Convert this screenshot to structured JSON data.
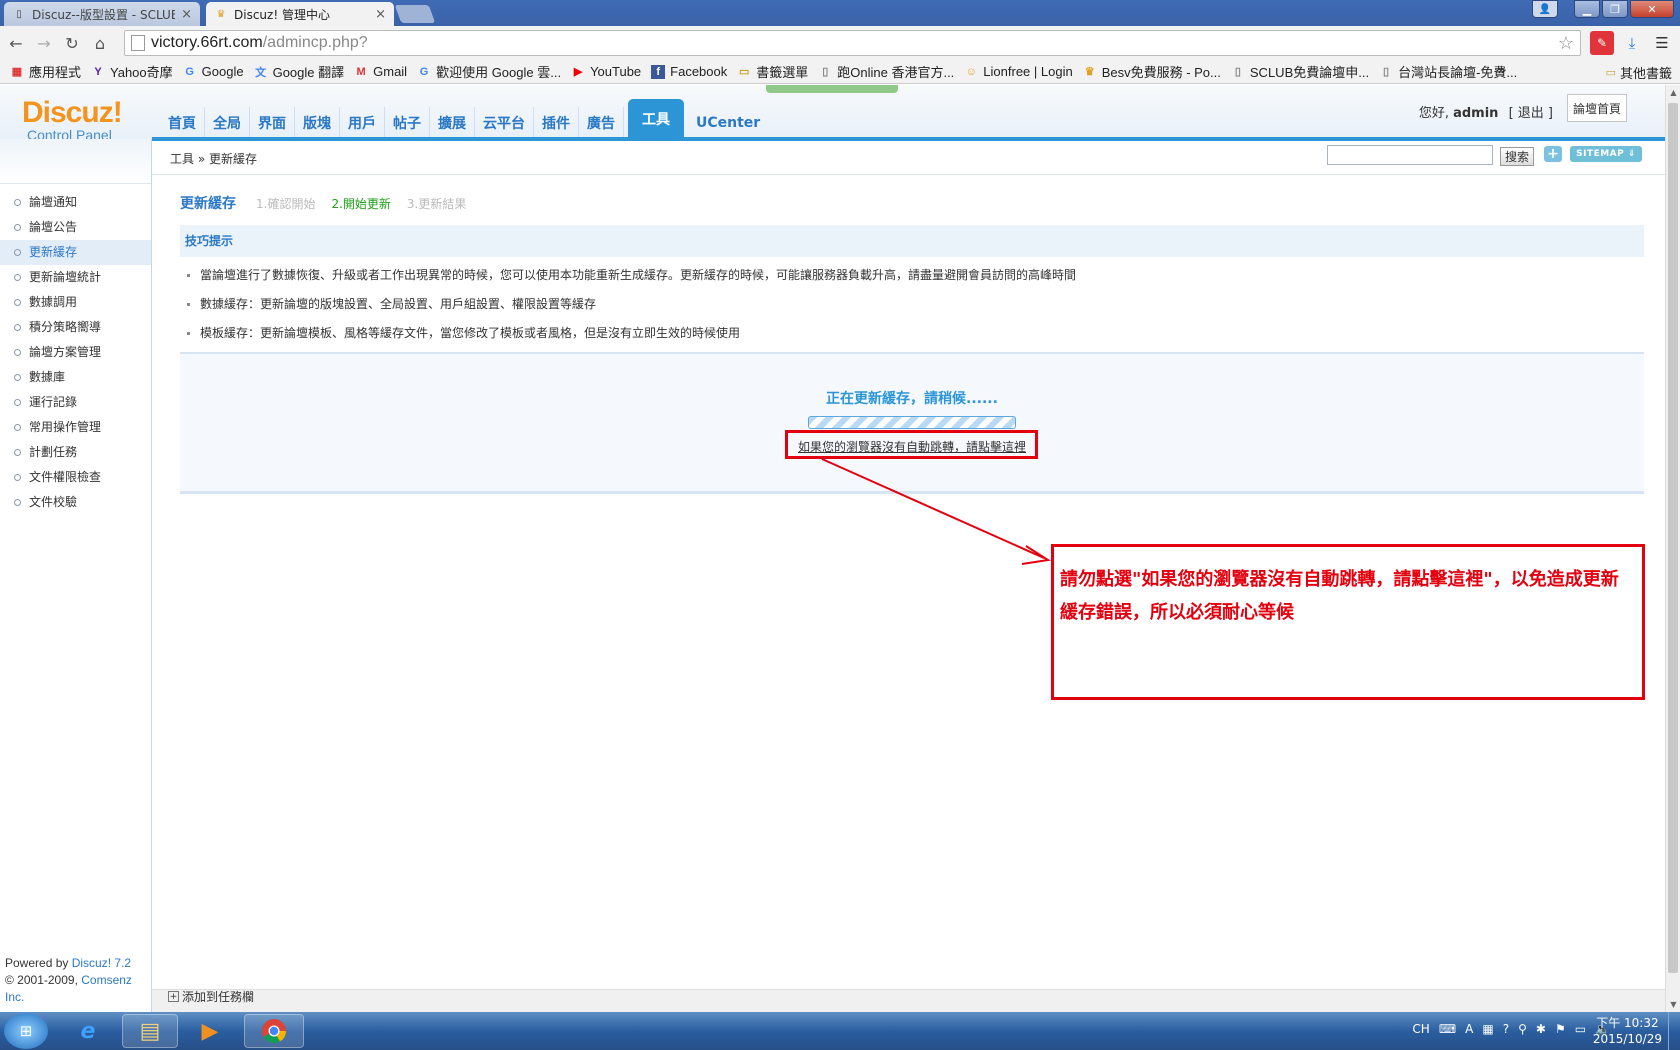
{
  "browser": {
    "tabs": [
      {
        "title": "Discuz--版型設置 - SCLUB",
        "active": false,
        "close": "×"
      },
      {
        "title": "Discuz! 管理中心",
        "active": true,
        "close": "×"
      }
    ],
    "window_controls": {
      "minimize": "▁",
      "maximize": "❐",
      "close": "✕"
    },
    "url_host": "victory.66rt.com",
    "url_path": "/admincp.php?",
    "bookmarks": [
      {
        "label": "應用程式",
        "icon": "apps-icon"
      },
      {
        "label": "Yahoo奇摩",
        "icon": "yahoo-icon"
      },
      {
        "label": "Google",
        "icon": "google-icon"
      },
      {
        "label": "Google 翻譯",
        "icon": "google-translate-icon"
      },
      {
        "label": "Gmail",
        "icon": "gmail-icon"
      },
      {
        "label": "歡迎使用 Google 雲...",
        "icon": "google-icon"
      },
      {
        "label": "YouTube",
        "icon": "youtube-icon"
      },
      {
        "label": "Facebook",
        "icon": "facebook-icon"
      },
      {
        "label": "書籤選單",
        "icon": "folder-icon"
      },
      {
        "label": "跑Online 香港官方...",
        "icon": "page-icon"
      },
      {
        "label": "Lionfree | Login",
        "icon": "lionfree-icon"
      },
      {
        "label": "Besv免費服務 - Po...",
        "icon": "trophy-icon"
      },
      {
        "label": "SCLUB免費論壇申...",
        "icon": "page-icon"
      },
      {
        "label": "台灣站長論壇-免費...",
        "icon": "page-icon"
      }
    ],
    "bookmarks_more": "»",
    "bookmarks_other": "其他書籤"
  },
  "header": {
    "logo_title": "Discuz!",
    "logo_sub": "Control Panel",
    "nav": [
      "首頁",
      "全局",
      "界面",
      "版塊",
      "用戶",
      "帖子",
      "擴展",
      "云平台",
      "插件",
      "廣告",
      "工具",
      "UCenter"
    ],
    "nav_active": "工具",
    "user_greeting": "您好,",
    "user_name": "admin",
    "logout": "[ 退出 ]",
    "forum_home": "論壇首頁"
  },
  "crumb": {
    "path": "工具 » 更新緩存",
    "search_button": "搜索",
    "plus": "+",
    "sitemap": "SITEMAP ⇓"
  },
  "sidebar": {
    "items": [
      {
        "label": "論壇通知"
      },
      {
        "label": "論壇公告"
      },
      {
        "label": "更新緩存",
        "active": true
      },
      {
        "label": "更新論壇統計"
      },
      {
        "label": "數據調用"
      },
      {
        "label": "積分策略嚮導"
      },
      {
        "label": "論壇方案管理"
      },
      {
        "label": "數據庫"
      },
      {
        "label": "運行記錄"
      },
      {
        "label": "常用操作管理"
      },
      {
        "label": "計劃任務"
      },
      {
        "label": "文件權限檢查"
      },
      {
        "label": "文件校驗"
      }
    ],
    "powered_by": "Powered by",
    "powered_link": "Discuz! 7.2",
    "copyright": "© 2001-2009,",
    "copyright_link": "Comsenz Inc."
  },
  "main": {
    "title": "更新緩存",
    "steps": [
      {
        "label": "1.確認開始",
        "current": false
      },
      {
        "label": "2.開始更新",
        "current": true
      },
      {
        "label": "3.更新結果",
        "current": false
      }
    ],
    "tip_title": "技巧提示",
    "tips": [
      "當論壇進行了數據恢復、升級或者工作出現異常的時候，您可以使用本功能重新生成緩存。更新緩存的時候，可能讓服務器負載升高，請盡量避開會員訪問的高峰時間",
      "數據緩存：更新論壇的版塊設置、全局設置、用戶組設置、權限設置等緩存",
      "模板緩存：更新論壇模板、風格等緩存文件，當您修改了模板或者風格，但是沒有立即生效的時候使用"
    ],
    "progress_title": "正在更新緩存，請稍候......",
    "redirect_link": "如果您的瀏覽器沒有自動跳轉，請點擊這裡"
  },
  "annotation": {
    "text": "請勿點選\"如果您的瀏覽器沒有自動跳轉，請點擊這裡\"，以免造成更新緩存錯誤，所以必須耐心等候",
    "color": "#e3000f"
  },
  "footer": {
    "add_task": "添加到任務欄"
  },
  "taskbar": {
    "start": "⊞",
    "apps": [
      "ie-icon",
      "explorer-icon",
      "media-player-icon",
      "chrome-icon"
    ],
    "tray_lang": "CH",
    "clock_time": "下午 10:32",
    "clock_date": "2015/10/29"
  }
}
